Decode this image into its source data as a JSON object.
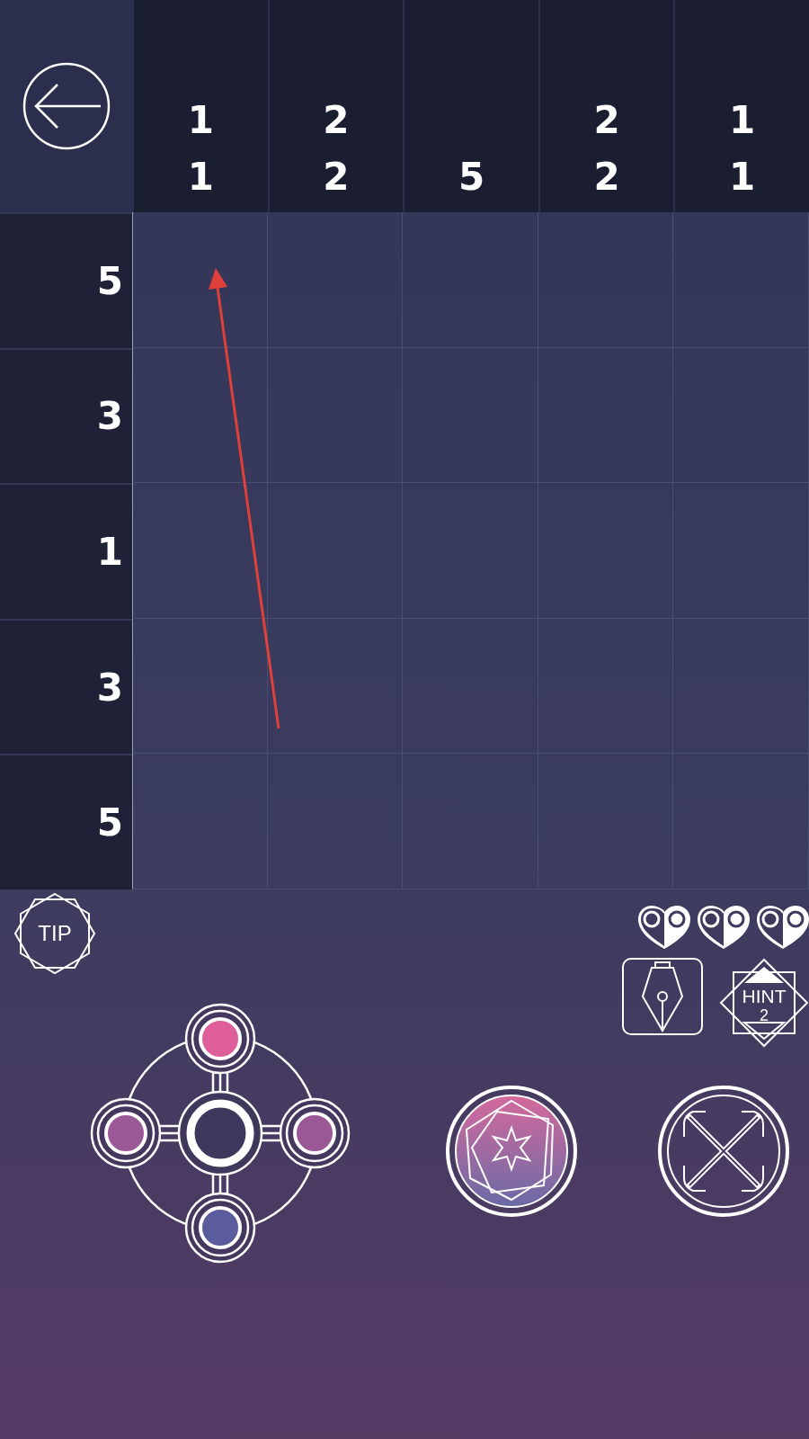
{
  "column_clues": [
    [
      "1",
      "1"
    ],
    [
      "2",
      "2"
    ],
    [
      "5"
    ],
    [
      "2",
      "2"
    ],
    [
      "1",
      "1"
    ]
  ],
  "row_clues": [
    "5",
    "3",
    "1",
    "3",
    "5"
  ],
  "grid": [
    [
      {
        "filled": false
      },
      {
        "filled": false
      },
      {
        "filled": false
      },
      {
        "filled": false
      },
      {
        "filled": false
      }
    ],
    [
      {
        "filled": false
      },
      {
        "filled": false
      },
      {
        "filled": false
      },
      {
        "filled": false
      },
      {
        "filled": false
      }
    ],
    [
      {
        "filled": false
      },
      {
        "filled": false
      },
      {
        "filled": false
      },
      {
        "filled": false
      },
      {
        "filled": false
      }
    ],
    [
      {
        "filled": false
      },
      {
        "filled": false
      },
      {
        "filled": false
      },
      {
        "filled": false
      },
      {
        "filled": false
      }
    ],
    [
      {
        "filled": false
      },
      {
        "filled": false
      },
      {
        "filled": false
      },
      {
        "filled": false
      },
      {
        "filled": false
      }
    ]
  ],
  "tip_button": {
    "label": "TIP"
  },
  "hint_button": {
    "label": "HINT",
    "count": "2"
  },
  "dpad": [
    {
      "kind": "up",
      "color": "#dd5e98"
    },
    {
      "kind": "left",
      "color": "#9a5996"
    },
    {
      "kind": "right",
      "color": "#9a5996"
    },
    {
      "kind": "down",
      "color": "#5b5c9c"
    }
  ]
}
